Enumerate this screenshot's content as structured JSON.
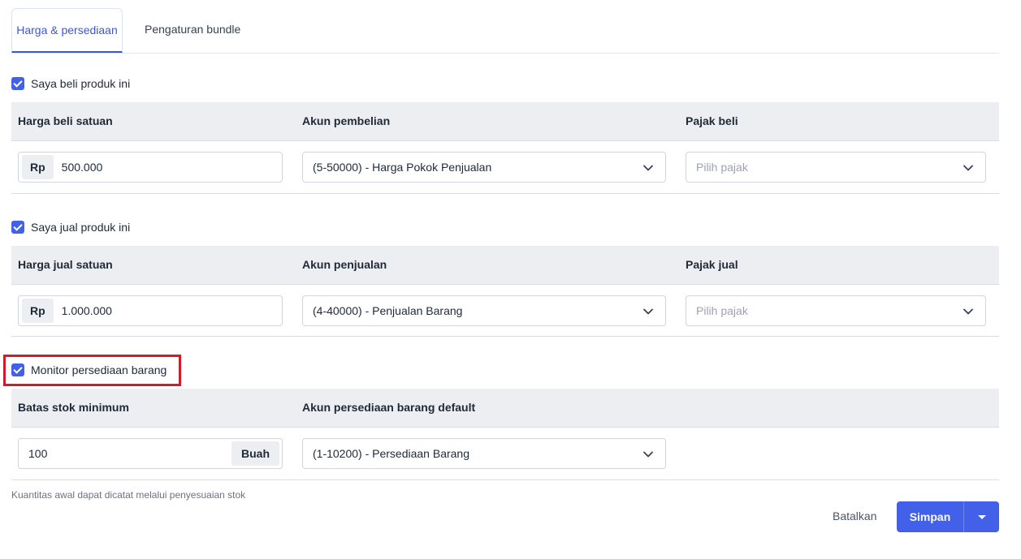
{
  "tabs": [
    {
      "label": "Harga & persediaan",
      "active": true
    },
    {
      "label": "Pengaturan bundle",
      "active": false
    }
  ],
  "purchase": {
    "checkbox_label": "Saya beli produk ini",
    "checked": true,
    "headers": [
      "Harga beli satuan",
      "Akun pembelian",
      "Pajak beli"
    ],
    "price_prefix": "Rp",
    "price_value": "500.000",
    "account_value": "(5-50000) - Harga Pokok Penjualan",
    "tax_placeholder": "Pilih pajak"
  },
  "sales": {
    "checkbox_label": "Saya jual produk ini",
    "checked": true,
    "headers": [
      "Harga jual satuan",
      "Akun penjualan",
      "Pajak jual"
    ],
    "price_prefix": "Rp",
    "price_value": "1.000.000",
    "account_value": "(4-40000) - Penjualan Barang",
    "tax_placeholder": "Pilih pajak"
  },
  "inventory": {
    "checkbox_label": "Monitor persediaan barang",
    "checked": true,
    "headers": [
      "Batas stok minimum",
      "Akun persediaan barang default"
    ],
    "min_stock_value": "100",
    "unit_suffix": "Buah",
    "account_value": "(1-10200) - Persediaan Barang",
    "hint": "Kuantitas awal dapat dicatat melalui penyesuaian stok"
  },
  "actions": {
    "cancel_label": "Batalkan",
    "save_label": "Simpan"
  },
  "colors": {
    "accent": "#4361e8",
    "highlight": "#d11a2a",
    "header_bg": "#eceef1"
  },
  "icons": {
    "checkbox": "check-icon",
    "dropdown": "chevron-down-icon",
    "save_menu": "caret-down-icon"
  }
}
